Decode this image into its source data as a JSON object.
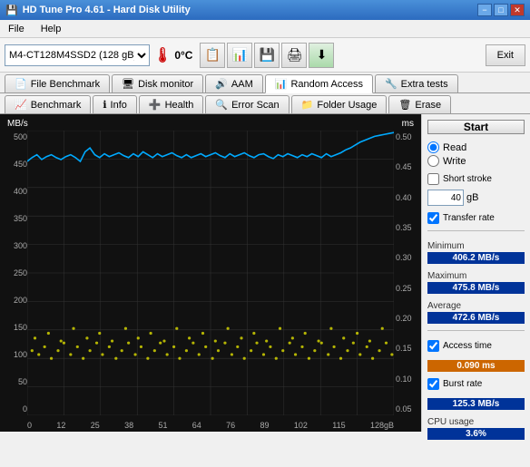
{
  "titleBar": {
    "title": "HD Tune Pro 4.61 - Hard Disk Utility",
    "icon": "💾",
    "btnMin": "−",
    "btnMax": "□",
    "btnClose": "✕"
  },
  "menuBar": {
    "items": [
      "File",
      "Help"
    ]
  },
  "toolbar": {
    "driveLabel": "M4-CT128M4SSD2 (128 gB)",
    "temp": "0°C",
    "exitLabel": "Exit"
  },
  "tabs1": [
    {
      "id": "file-benchmark",
      "icon": "📄",
      "label": "File Benchmark"
    },
    {
      "id": "disk-monitor",
      "icon": "🖥",
      "label": "Disk monitor"
    },
    {
      "id": "aam",
      "icon": "🔊",
      "label": "AAM"
    },
    {
      "id": "random-access",
      "icon": "📊",
      "label": "Random Access",
      "active": true
    },
    {
      "id": "extra-tests",
      "icon": "🔧",
      "label": "Extra tests"
    }
  ],
  "tabs2": [
    {
      "id": "benchmark",
      "icon": "📈",
      "label": "Benchmark"
    },
    {
      "id": "info",
      "icon": "ℹ",
      "label": "Info"
    },
    {
      "id": "health",
      "icon": "➕",
      "label": "Health"
    },
    {
      "id": "error-scan",
      "icon": "🔍",
      "label": "Error Scan"
    },
    {
      "id": "folder-usage",
      "icon": "📁",
      "label": "Folder Usage"
    },
    {
      "id": "erase",
      "icon": "🗑",
      "label": "Erase"
    }
  ],
  "chart": {
    "leftAxisLabel": "MB/s",
    "rightAxisLabel": "ms",
    "yLabelsLeft": [
      "500",
      "450",
      "400",
      "350",
      "300",
      "250",
      "200",
      "150",
      "100",
      "50",
      "0"
    ],
    "yLabelsRight": [
      "0.50",
      "0.45",
      "0.40",
      "0.35",
      "0.30",
      "0.25",
      "0.20",
      "0.15",
      "0.10",
      "0.05"
    ],
    "xLabels": [
      "0",
      "12",
      "25",
      "38",
      "51",
      "64",
      "76",
      "89",
      "102",
      "115",
      "128gB"
    ]
  },
  "rightPanel": {
    "startLabel": "Start",
    "readLabel": "Read",
    "writeLabel": "Write",
    "shortStrokeLabel": "Short stroke",
    "shortStrokeValue": "40",
    "gbLabel": "gB",
    "transferRateLabel": "Transfer rate",
    "minimumLabel": "Minimum",
    "minimumValue": "406.2 MB/s",
    "maximumLabel": "Maximum",
    "maximumValue": "475.8 MB/s",
    "averageLabel": "Average",
    "averageValue": "472.6 MB/s",
    "accessTimeLabel": "Access time",
    "accessTimeValue": "0.090 ms",
    "burstRateLabel": "Burst rate",
    "burstRateValue": "125.3 MB/s",
    "cpuUsageLabel": "CPU usage",
    "cpuUsageValue": "3.6%"
  }
}
